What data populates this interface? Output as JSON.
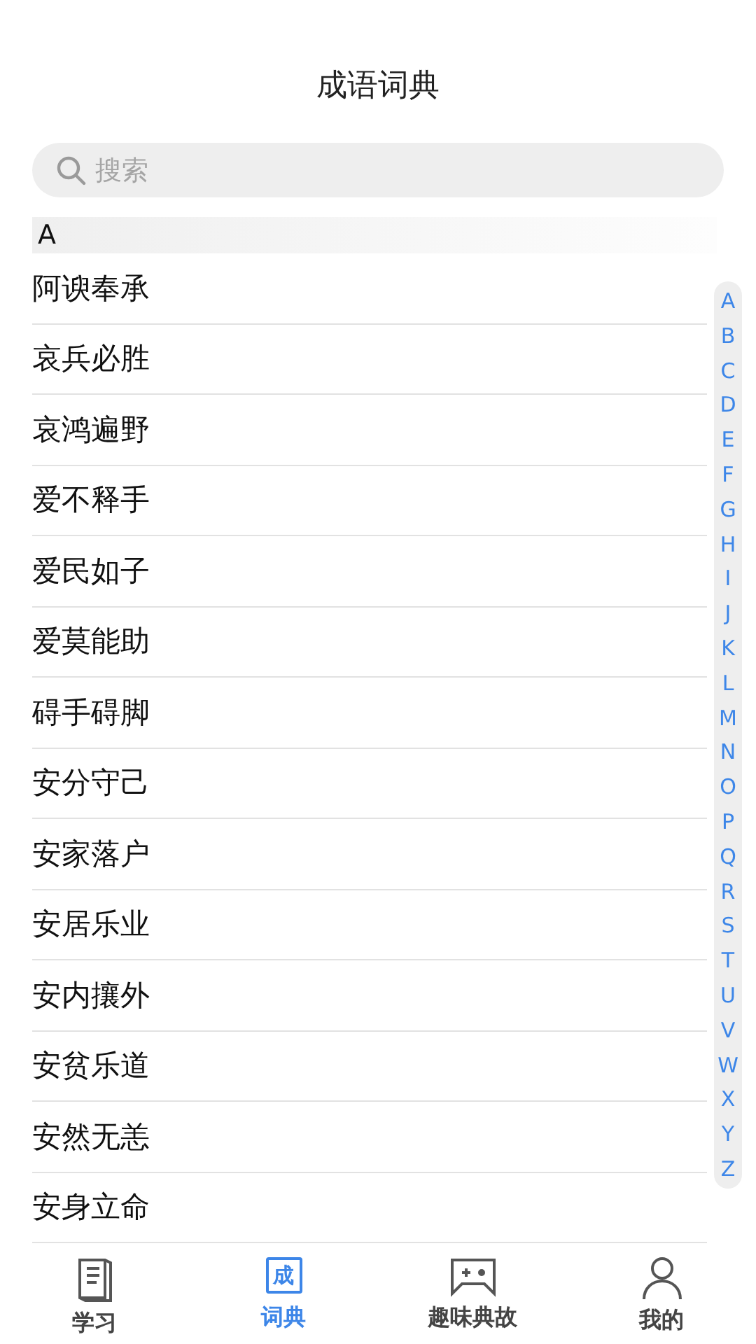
{
  "title": "成语词典",
  "search": {
    "placeholder": "搜索"
  },
  "section": {
    "header": "A",
    "items": [
      "阿谀奉承",
      "哀兵必胜",
      "哀鸿遍野",
      "爱不释手",
      "爱民如子",
      "爱莫能助",
      "碍手碍脚",
      "安分守己",
      "安家落户",
      "安居乐业",
      "安内攘外",
      "安贫乐道",
      "安然无恙",
      "安身立命"
    ]
  },
  "index": [
    "A",
    "B",
    "C",
    "D",
    "E",
    "F",
    "G",
    "H",
    "I",
    "J",
    "K",
    "L",
    "M",
    "N",
    "O",
    "P",
    "Q",
    "R",
    "S",
    "T",
    "U",
    "V",
    "W",
    "X",
    "Y",
    "Z"
  ],
  "tabs": [
    {
      "kind": "book",
      "label": "学习",
      "selected": false
    },
    {
      "kind": "char",
      "icon_text": "成",
      "label": "词典",
      "selected": true
    },
    {
      "kind": "game",
      "label": "趣味典故",
      "selected": false
    },
    {
      "kind": "person",
      "label": "我的",
      "selected": false
    }
  ]
}
